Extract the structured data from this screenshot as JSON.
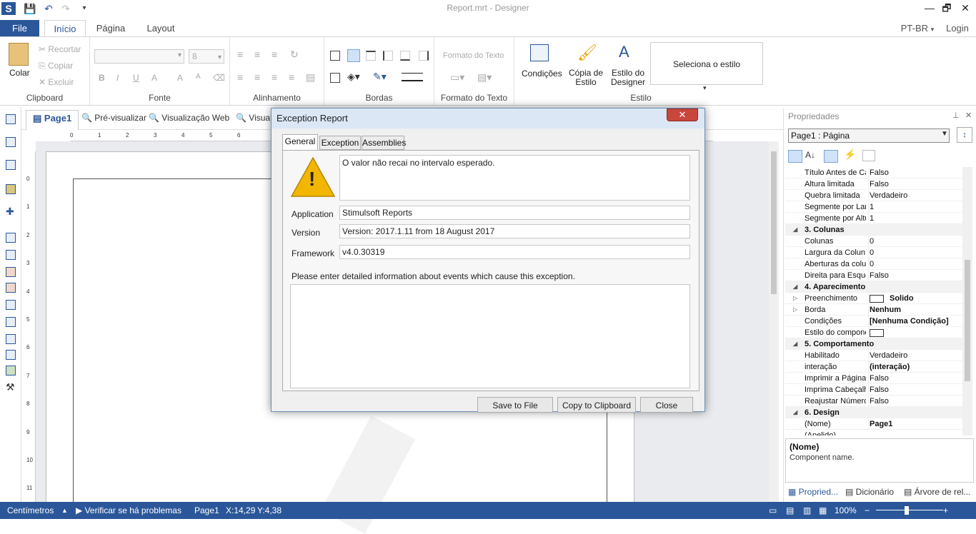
{
  "window": {
    "title": "Report.mrt - Designer",
    "minimize": "—",
    "restore": "🗗",
    "close": "✕"
  },
  "quick_access": {
    "logo": "S",
    "save_icon": "💾",
    "undo_icon": "↶",
    "redo_icon": "↷",
    "more_icon": "▾"
  },
  "ribbon_tabs": [
    {
      "label": "File"
    },
    {
      "label": "Início"
    },
    {
      "label": "Página"
    },
    {
      "label": "Layout"
    }
  ],
  "top_right": {
    "language": "PT-BR",
    "login": "Login"
  },
  "ribbon": {
    "clipboard": {
      "paste": "Colar",
      "cut": "Recortar",
      "copy": "Copiar",
      "delete": "Excluir",
      "label": "Clipboard"
    },
    "font": {
      "size_value": "8",
      "bold": "B",
      "italic": "I",
      "underline": "U",
      "font_color": "A",
      "grow": "A",
      "shrink": "A",
      "label": "Fonte"
    },
    "alignment": {
      "label": "Alinhamento"
    },
    "borders": {
      "label": "Bordas"
    },
    "text_format": {
      "combo_text": "Formato do Texto",
      "label": "Formato do Texto"
    },
    "style": {
      "conditions": "Condições",
      "copy_style": "Cópia de Estilo",
      "designer_style": "Estilo do Designer",
      "select_style": "Seleciona o estilo",
      "label": "Estilo"
    }
  },
  "doc_tabs": {
    "page1": "Page1",
    "preview": "Pré-visualizar",
    "web_preview": "Visualização Web",
    "visual": "Visual"
  },
  "ruler": {
    "h_ticks": [
      "0",
      "1",
      "2",
      "3",
      "4",
      "5",
      "6"
    ],
    "v_ticks": [
      "0",
      "1",
      "2",
      "3",
      "4",
      "5",
      "6",
      "7",
      "8",
      "9",
      "10",
      "11"
    ]
  },
  "dialog": {
    "title": "Exception Report",
    "close_icon": "✕",
    "tabs": [
      "General",
      "Exception",
      "Assemblies"
    ],
    "message": "O valor não recai no intervalo esperado.",
    "warning_icon": "!",
    "application_label": "Application",
    "application_value": "Stimulsoft Reports",
    "version_label": "Version",
    "version_value": "Version: 2017.1.11 from 18 August 2017",
    "framework_label": "Framework",
    "framework_value": "v4.0.30319",
    "details_prompt": "Please enter detailed information about events which cause this exception.",
    "details_value": "",
    "buttons": {
      "save": "Save to File",
      "copy": "Copy to Clipboard",
      "close": "Close"
    }
  },
  "properties": {
    "title": "Propriedades",
    "pin_icon": "⊥",
    "close_icon": "✕",
    "selector": "Page1 : Página",
    "rows": [
      {
        "kind": "prop",
        "name": "Título Antes de Ca",
        "value": "Falso"
      },
      {
        "kind": "prop",
        "name": "Altura limitada",
        "value": "Falso"
      },
      {
        "kind": "prop",
        "name": "Quebra limitada",
        "value": "Verdadeiro"
      },
      {
        "kind": "prop",
        "name": "Segmente por Lar",
        "value": "1"
      },
      {
        "kind": "prop",
        "name": "Segmente por Altu",
        "value": "1"
      },
      {
        "kind": "cat",
        "name": "3. Colunas"
      },
      {
        "kind": "prop",
        "name": "Colunas",
        "value": "0"
      },
      {
        "kind": "prop",
        "name": "Largura da Colun",
        "value": "0"
      },
      {
        "kind": "prop",
        "name": "Aberturas da colu",
        "value": "0"
      },
      {
        "kind": "prop",
        "name": "Direita para Esque",
        "value": "Falso"
      },
      {
        "kind": "cat",
        "name": "4. Aparecimento"
      },
      {
        "kind": "prop",
        "name": "Preenchimento",
        "value": "Solido",
        "bold": true,
        "expand": true,
        "swatch": true
      },
      {
        "kind": "prop",
        "name": "Borda",
        "value": "Nenhum",
        "bold": true,
        "expand": true
      },
      {
        "kind": "prop",
        "name": "Condições",
        "value": "[Nenhuma Condição]",
        "bold": true
      },
      {
        "kind": "prop",
        "name": "Estilo do compone",
        "value": "",
        "swatch": true
      },
      {
        "kind": "cat",
        "name": "5. Comportamento"
      },
      {
        "kind": "prop",
        "name": "Habilitado",
        "value": "Verdadeiro"
      },
      {
        "kind": "prop",
        "name": "interação",
        "value": "(interação)",
        "bold": true
      },
      {
        "kind": "prop",
        "name": "Imprimir a Página",
        "value": "Falso"
      },
      {
        "kind": "prop",
        "name": "Imprima Cabeçalh",
        "value": "Falso"
      },
      {
        "kind": "prop",
        "name": "Reajustar Número",
        "value": "Falso"
      },
      {
        "kind": "cat",
        "name": "6. Design"
      },
      {
        "kind": "prop",
        "name": "(Nome)",
        "value": "Page1",
        "bold": true
      },
      {
        "kind": "prop",
        "name": "(Apelido)",
        "value": ""
      }
    ],
    "desc_title": "(Nome)",
    "desc_text": "Component name.",
    "bottom_tabs": [
      "Propried...",
      "Dicionário",
      "Árvore de rel..."
    ]
  },
  "status": {
    "units": "Centímetros",
    "check": "Verificar se há problemas",
    "page": "Page1",
    "x": "X:14,29",
    "y": "Y:4,38",
    "zoom": "100%"
  },
  "colors": {
    "accent": "#2b579a",
    "dialog_close": "#c9463d"
  }
}
